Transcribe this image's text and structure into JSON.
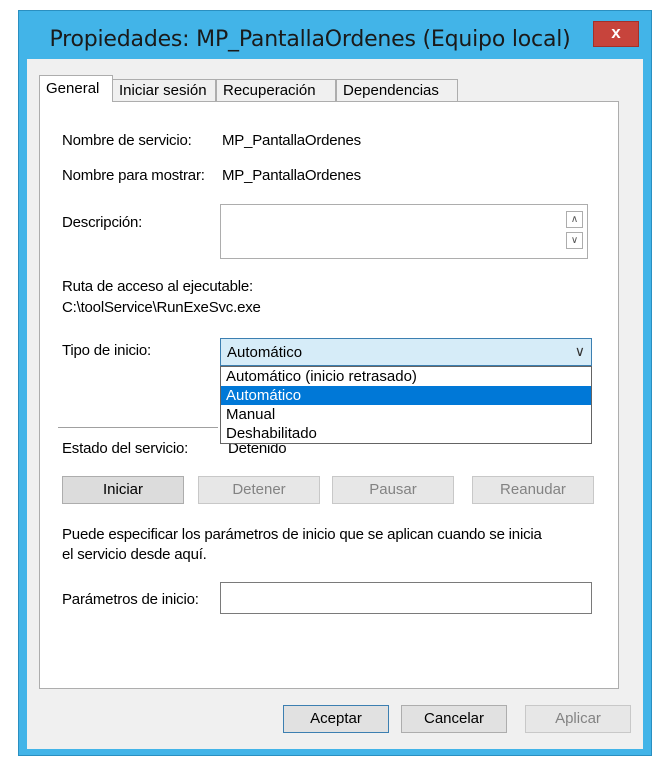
{
  "window": {
    "title": "Propiedades: MP_PantallaOrdenes (Equipo local)",
    "close_glyph": "x"
  },
  "tabs": [
    {
      "label": "General"
    },
    {
      "label": "Iniciar sesión"
    },
    {
      "label": "Recuperación"
    },
    {
      "label": "Dependencias"
    }
  ],
  "general": {
    "service_name_label": "Nombre de servicio:",
    "service_name_value": "MP_PantallaOrdenes",
    "display_name_label": "Nombre para mostrar:",
    "display_name_value": "MP_PantallaOrdenes",
    "description_label": "Descripción:",
    "path_label": "Ruta de acceso al ejecutable:",
    "path_value": "C:\\toolService\\RunExeSvc.exe",
    "startup_type_label": "Tipo de inicio:",
    "startup_type_value": "Automático",
    "startup_options": [
      "Automático (inicio retrasado)",
      "Automático",
      "Manual",
      "Deshabilitado"
    ],
    "status_label": "Estado del servicio:",
    "status_value": "Detenido",
    "start_button": "Iniciar",
    "stop_button": "Detener",
    "pause_button": "Pausar",
    "resume_button": "Reanudar",
    "info_text_line1": "Puede especificar los parámetros de inicio que se aplican cuando se inicia",
    "info_text_line2": "el servicio desde aquí.",
    "params_label": "Parámetros de inicio:",
    "params_value": ""
  },
  "footer": {
    "ok_button": "Aceptar",
    "cancel_button": "Cancelar",
    "apply_button": "Aplicar"
  },
  "colors": {
    "titlebar": "#42b4e8",
    "close_button": "#c7443c",
    "selection": "#0078d7"
  },
  "icons": {
    "scroll_up": "chevron-up-icon",
    "scroll_down": "chevron-down-icon",
    "dropdown": "chevron-down-icon"
  }
}
